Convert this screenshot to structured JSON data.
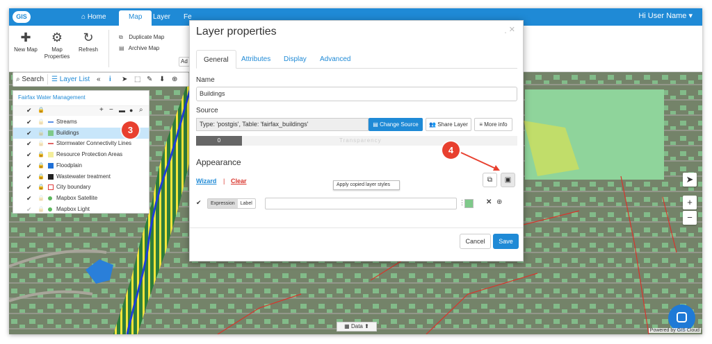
{
  "topbar": {
    "logo": "GIS",
    "nav": {
      "home": "Home",
      "map": "Map",
      "layer": "Layer",
      "extra": "Fe"
    },
    "user": "Hi User Name ▾"
  },
  "ribbon": {
    "new_map": "New Map",
    "map_properties": "Map Properties",
    "refresh": "Refresh",
    "duplicate_map": "Duplicate Map",
    "archive_map": "Archive Map",
    "partial": "Ad"
  },
  "map_toolbar": {
    "search": "Search",
    "layer_list": "Layer List"
  },
  "layer_panel": {
    "title": "Fairfax Water Management",
    "layers": [
      {
        "label": "Streams",
        "symbol": "line",
        "color": "#5a8fe6"
      },
      {
        "label": "Buildings",
        "symbol": "fill",
        "color": "#7fc98a",
        "selected": true
      },
      {
        "label": "Stormwater Connectivity Lines",
        "symbol": "line",
        "color": "#e06464"
      },
      {
        "label": "Resource Protection Areas",
        "symbol": "fill",
        "color": "#f4ee9a"
      },
      {
        "label": "Floodplain",
        "symbol": "fill",
        "color": "#1f6fd6"
      },
      {
        "label": "Wastewater treatment",
        "symbol": "icon",
        "color": "#222222"
      },
      {
        "label": "City boundary",
        "symbol": "outline",
        "color": "#e03a3a"
      },
      {
        "label": "Mapbox Satellite",
        "symbol": "dot",
        "color": "#5cb85c"
      },
      {
        "label": "Mapbox Light",
        "symbol": "dot",
        "color": "#5cb85c"
      }
    ]
  },
  "callouts": {
    "three": "3",
    "four": "4"
  },
  "dialog": {
    "title": "Layer properties",
    "tabs": [
      "General",
      "Attributes",
      "Display",
      "Advanced"
    ],
    "name_label": "Name",
    "name_value": "Buildings",
    "source_label": "Source",
    "source_value": "Type: 'postgis', Table: 'fairfax_buildings'",
    "change_source": "Change Source",
    "share_layer": "Share Layer",
    "more_info": "More info",
    "transparency_value": "0",
    "transparency_label": "Transparency",
    "appearance": "Appearance",
    "wizard": "Wizard",
    "separator": "|",
    "clear": "Clear",
    "tooltip": "Apply copied layer styles",
    "expression_tab": "Expression",
    "label_tab": "Label",
    "style_color": "#7fc98a",
    "cancel": "Cancel",
    "save": "Save"
  },
  "bottom": {
    "data": "Data",
    "powered": "Powered by GIS Cloud"
  },
  "colors": {
    "accent": "#1f8ad6",
    "danger": "#d9342b",
    "callout": "#e8402f"
  }
}
